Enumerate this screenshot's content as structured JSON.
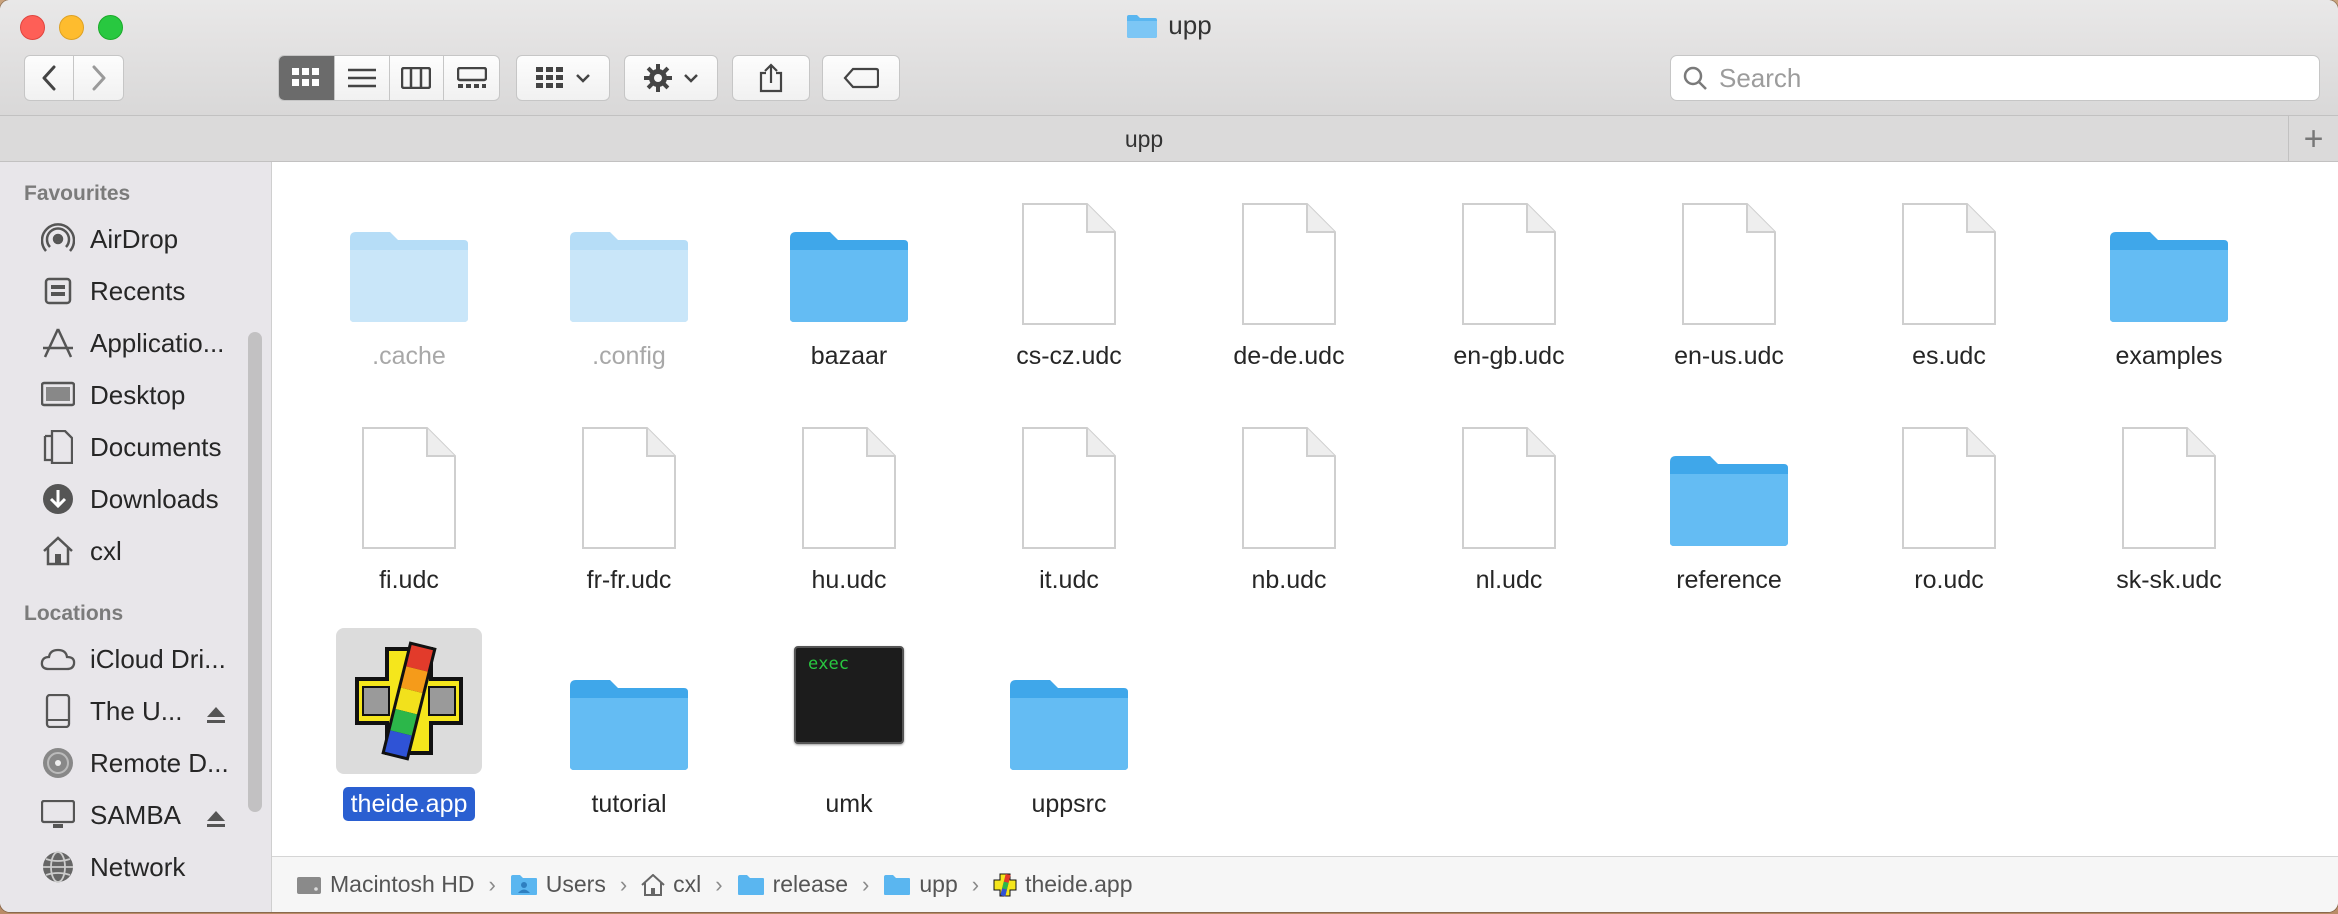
{
  "window": {
    "title": "upp"
  },
  "toolbar": {
    "back_icon": "chevron-left-icon",
    "forward_icon": "chevron-right-icon",
    "view_modes": [
      "icon-view",
      "list-view",
      "column-view",
      "gallery-view"
    ],
    "active_view": "icon-view",
    "search_placeholder": "Search"
  },
  "tabbar": {
    "label": "upp",
    "add_label": "+"
  },
  "sidebar": {
    "favourites_heading": "Favourites",
    "favourites": [
      {
        "label": "AirDrop",
        "icon": "airdrop-icon"
      },
      {
        "label": "Recents",
        "icon": "recents-icon"
      },
      {
        "label": "Applicatio...",
        "icon": "applications-icon"
      },
      {
        "label": "Desktop",
        "icon": "desktop-icon"
      },
      {
        "label": "Documents",
        "icon": "documents-icon"
      },
      {
        "label": "Downloads",
        "icon": "downloads-icon"
      },
      {
        "label": "cxl",
        "icon": "home-icon"
      }
    ],
    "locations_heading": "Locations",
    "locations": [
      {
        "label": "iCloud Dri...",
        "icon": "icloud-icon"
      },
      {
        "label": "The U...",
        "icon": "drive-icon",
        "eject": true
      },
      {
        "label": "Remote D...",
        "icon": "disc-icon"
      },
      {
        "label": "SAMBA",
        "icon": "display-icon",
        "eject": true
      },
      {
        "label": "Network",
        "icon": "network-icon"
      }
    ]
  },
  "files": [
    {
      "name": ".cache",
      "kind": "folder",
      "hidden": true
    },
    {
      "name": ".config",
      "kind": "folder",
      "hidden": true
    },
    {
      "name": "bazaar",
      "kind": "folder"
    },
    {
      "name": "cs-cz.udc",
      "kind": "document"
    },
    {
      "name": "de-de.udc",
      "kind": "document"
    },
    {
      "name": "en-gb.udc",
      "kind": "document"
    },
    {
      "name": "en-us.udc",
      "kind": "document"
    },
    {
      "name": "es.udc",
      "kind": "document"
    },
    {
      "name": "examples",
      "kind": "folder"
    },
    {
      "name": "fi.udc",
      "kind": "document"
    },
    {
      "name": "fr-fr.udc",
      "kind": "document"
    },
    {
      "name": "hu.udc",
      "kind": "document"
    },
    {
      "name": "it.udc",
      "kind": "document"
    },
    {
      "name": "nb.udc",
      "kind": "document"
    },
    {
      "name": "nl.udc",
      "kind": "document"
    },
    {
      "name": "reference",
      "kind": "folder"
    },
    {
      "name": "ro.udc",
      "kind": "document"
    },
    {
      "name": "sk-sk.udc",
      "kind": "document"
    },
    {
      "name": "theide.app",
      "kind": "app",
      "selected": true
    },
    {
      "name": "tutorial",
      "kind": "folder"
    },
    {
      "name": "umk",
      "kind": "exec",
      "exec_text": "exec"
    },
    {
      "name": "uppsrc",
      "kind": "folder"
    }
  ],
  "pathbar": [
    {
      "label": "Macintosh HD",
      "icon": "harddisk-icon"
    },
    {
      "label": "Users",
      "icon": "users-folder-icon"
    },
    {
      "label": "cxl",
      "icon": "home-icon"
    },
    {
      "label": "release",
      "icon": "folder-icon"
    },
    {
      "label": "upp",
      "icon": "folder-icon"
    },
    {
      "label": "theide.app",
      "icon": "theide-app-icon"
    }
  ],
  "colors": {
    "folder": "#5ab6f0",
    "selection": "#2a5fd1"
  }
}
